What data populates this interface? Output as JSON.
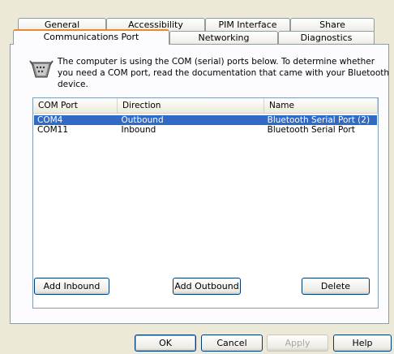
{
  "tabs_row_back": [
    {
      "label": "General"
    },
    {
      "label": "Accessibility"
    },
    {
      "label": "PIM Interface"
    },
    {
      "label": "Share"
    }
  ],
  "tabs_row_front": [
    {
      "label": "Communications Port",
      "active": true
    },
    {
      "label": "Networking"
    },
    {
      "label": "Diagnostics"
    }
  ],
  "info": {
    "text": "The computer is using the COM (serial) ports below.  To determine whether you need a COM port, read the documentation that came with your Bluetooth device.",
    "icon": "serial-port-icon"
  },
  "list": {
    "columns": [
      "COM Port",
      "Direction",
      "Name"
    ],
    "rows": [
      {
        "port": "COM4",
        "direction": "Outbound",
        "name": "Bluetooth Serial Port (2)",
        "selected": true
      },
      {
        "port": "COM11",
        "direction": "Inbound",
        "name": "Bluetooth Serial Port",
        "selected": false
      }
    ]
  },
  "panel_buttons": {
    "add_inbound": "Add Inbound",
    "add_outbound": "Add Outbound",
    "delete": "Delete"
  },
  "dialog_buttons": {
    "ok": "OK",
    "cancel": "Cancel",
    "apply": "Apply",
    "help": "Help"
  },
  "colors": {
    "selection": "#316ac5",
    "active_tab_accent": "#e68b2c",
    "dialog_bg": "#ece9d8"
  }
}
